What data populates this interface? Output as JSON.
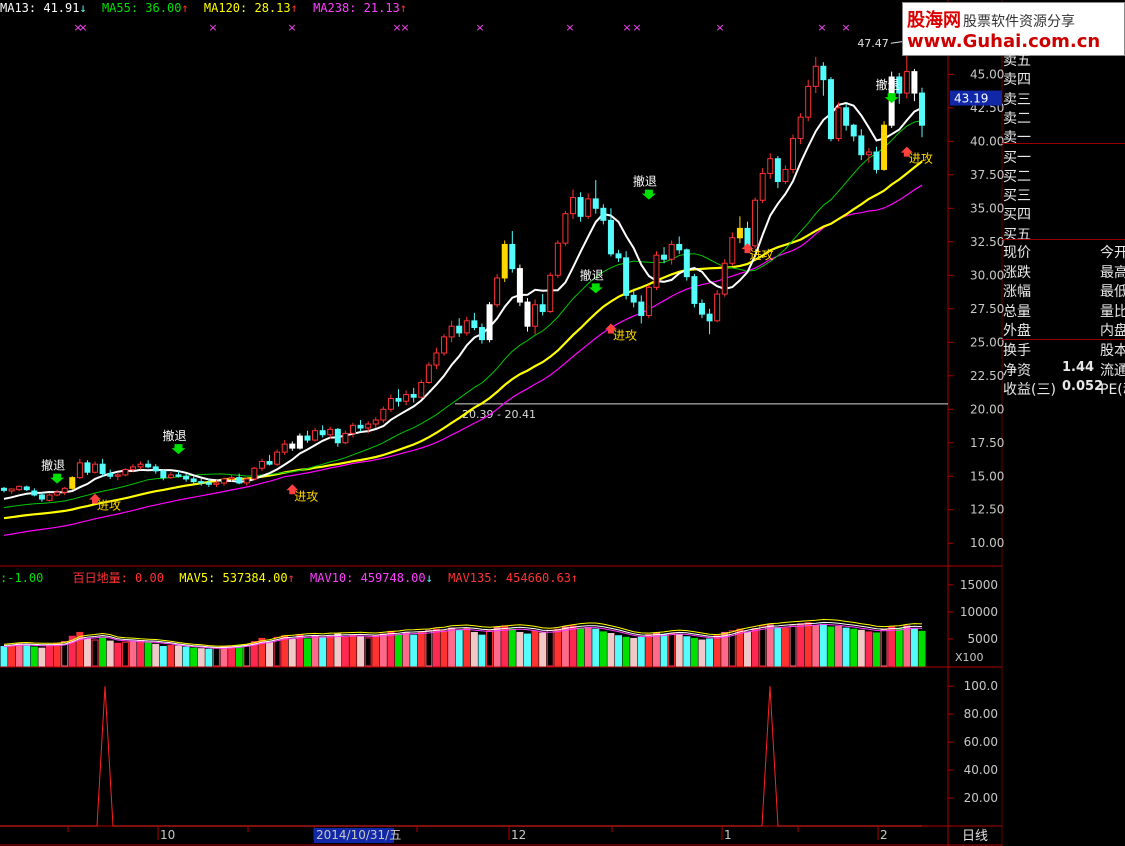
{
  "legend": {
    "ma13": "MA13: 41.91",
    "ma13_arrow": "↓",
    "ma55": "MA55: 36.00",
    "ma55_arrow": "↑",
    "ma120": "MA120: 28.13",
    "ma120_arrow": "↑",
    "ma238": "MA238: 21.13",
    "ma238_arrow": "↑"
  },
  "volume_legend": {
    "prefix": ":-1.00",
    "bairi": "百日地量: 0.00",
    "mav5": "MAV5: 537384.00",
    "mav5_arrow": "↑",
    "mav10": "MAV10: 459748.00",
    "mav10_arrow": "↓",
    "mav135": "MAV135: 454660.63",
    "mav135_arrow": "↑"
  },
  "watermark": {
    "brand": "股海网",
    "slogan": "股票软件资源分享",
    "url": "www.Guhai.com.cn"
  },
  "side_panel": {
    "order_book": [
      "卖五",
      "卖四",
      "卖三",
      "卖二",
      "卖一",
      "买一",
      "买二",
      "买三",
      "买四",
      "买五"
    ],
    "rows": [
      {
        "left": "现价",
        "right": "今开"
      },
      {
        "left": "涨跌",
        "right": "最高"
      },
      {
        "left": "涨幅",
        "right": "最低"
      },
      {
        "left": "总量",
        "right": "量比"
      },
      {
        "left": "外盘",
        "right": "内盘"
      }
    ],
    "rows2": [
      {
        "left": "换手",
        "value": "",
        "right": "股本"
      },
      {
        "left": "净资",
        "value": "1.44",
        "right": "流通"
      },
      {
        "left": "收益(三)",
        "value": "0.052",
        "right": "PE(动"
      }
    ]
  },
  "colors": {
    "up": "#ff3232",
    "down": "#54fcfc",
    "ma13": "#ffffff",
    "ma55": "#00c800",
    "ma120": "#ffff00",
    "ma238": "#ff00ff",
    "axis": "#b00000",
    "attack_bar": "#ffd700"
  },
  "chart_data": [
    {
      "type": "candlestick",
      "title": "",
      "yticks": [
        10.0,
        12.5,
        15.0,
        17.5,
        20.0,
        22.5,
        25.0,
        27.5,
        30.0,
        32.5,
        35.0,
        37.5,
        40.0,
        42.5,
        45.0,
        47.5
      ],
      "ylim": [
        8.6,
        49.8
      ],
      "current_price": "43.19",
      "high_label": "47.47",
      "range_label": "20.39 - 20.41",
      "reference_line": 20.4,
      "signals": {
        "retreat": "撤退",
        "attack": "进攻"
      },
      "candles": [
        [
          14.1,
          14.2,
          13.8,
          13.95
        ],
        [
          13.9,
          14.1,
          13.7,
          14.05
        ],
        [
          14.0,
          14.3,
          13.9,
          14.25
        ],
        [
          14.2,
          14.3,
          13.9,
          14.0
        ],
        [
          13.9,
          14.1,
          13.5,
          13.6
        ],
        [
          13.6,
          13.8,
          13.1,
          13.3
        ],
        [
          13.2,
          13.7,
          13.1,
          13.6
        ],
        [
          13.6,
          14.0,
          13.5,
          13.8
        ],
        [
          13.8,
          14.2,
          13.6,
          14.1
        ],
        [
          14.1,
          15.0,
          14.0,
          14.9
        ],
        [
          14.9,
          16.3,
          14.8,
          16.0
        ],
        [
          16.0,
          16.2,
          15.1,
          15.3
        ],
        [
          15.3,
          16.1,
          15.2,
          15.9
        ],
        [
          15.9,
          16.3,
          15.0,
          15.2
        ],
        [
          15.2,
          15.5,
          14.8,
          15.0
        ],
        [
          15.0,
          15.3,
          14.7,
          15.1
        ],
        [
          15.1,
          15.6,
          15.0,
          15.5
        ],
        [
          15.5,
          15.9,
          15.3,
          15.7
        ],
        [
          15.7,
          16.1,
          15.5,
          15.9
        ],
        [
          15.9,
          16.2,
          15.6,
          15.7
        ],
        [
          15.7,
          15.9,
          15.2,
          15.4
        ],
        [
          15.4,
          15.5,
          14.7,
          14.9
        ],
        [
          14.9,
          15.3,
          14.8,
          15.1
        ],
        [
          15.1,
          15.4,
          14.9,
          15.0
        ],
        [
          15.0,
          15.2,
          14.6,
          14.8
        ],
        [
          14.8,
          15.0,
          14.4,
          14.6
        ],
        [
          14.6,
          14.8,
          14.3,
          14.5
        ],
        [
          14.5,
          14.8,
          14.2,
          14.4
        ],
        [
          14.4,
          14.7,
          14.2,
          14.5
        ],
        [
          14.5,
          14.9,
          14.3,
          14.8
        ],
        [
          14.8,
          15.1,
          14.6,
          14.9
        ],
        [
          14.9,
          15.2,
          14.4,
          14.5
        ],
        [
          14.5,
          14.9,
          14.3,
          14.8
        ],
        [
          14.8,
          15.7,
          14.7,
          15.6
        ],
        [
          15.6,
          16.3,
          15.4,
          16.1
        ],
        [
          16.1,
          16.6,
          15.8,
          15.9
        ],
        [
          15.9,
          17.0,
          15.8,
          16.8
        ],
        [
          16.8,
          17.7,
          16.6,
          17.4
        ],
        [
          17.4,
          17.6,
          16.9,
          17.1
        ],
        [
          17.1,
          18.2,
          17.0,
          18.0
        ],
        [
          18.0,
          18.4,
          17.5,
          17.7
        ],
        [
          17.7,
          18.6,
          17.6,
          18.4
        ],
        [
          18.4,
          18.8,
          17.9,
          18.1
        ],
        [
          18.1,
          18.7,
          17.8,
          18.5
        ],
        [
          18.5,
          18.6,
          17.2,
          17.5
        ],
        [
          17.5,
          18.4,
          17.4,
          18.2
        ],
        [
          18.2,
          19.0,
          17.9,
          18.8
        ],
        [
          18.8,
          19.2,
          18.3,
          18.6
        ],
        [
          18.6,
          19.1,
          18.2,
          18.9
        ],
        [
          18.9,
          19.4,
          18.6,
          19.2
        ],
        [
          19.2,
          20.2,
          19.0,
          20.0
        ],
        [
          20.0,
          21.1,
          19.8,
          20.8
        ],
        [
          20.8,
          21.5,
          20.2,
          20.6
        ],
        [
          20.6,
          21.4,
          20.3,
          21.1
        ],
        [
          21.1,
          21.6,
          20.5,
          20.9
        ],
        [
          20.9,
          22.2,
          20.8,
          22.0
        ],
        [
          22.0,
          23.5,
          21.9,
          23.3
        ],
        [
          23.3,
          24.6,
          23.0,
          24.2
        ],
        [
          24.2,
          25.6,
          24.0,
          25.4
        ],
        [
          25.4,
          26.6,
          25.0,
          26.2
        ],
        [
          26.2,
          26.8,
          25.4,
          25.7
        ],
        [
          25.7,
          26.9,
          25.5,
          26.6
        ],
        [
          26.6,
          27.2,
          25.9,
          26.1
        ],
        [
          26.1,
          26.4,
          24.9,
          25.2
        ],
        [
          25.2,
          28.0,
          25.0,
          27.8
        ],
        [
          27.8,
          30.1,
          27.6,
          29.8
        ],
        [
          29.8,
          32.6,
          29.5,
          32.3
        ],
        [
          32.3,
          33.3,
          30.2,
          30.5
        ],
        [
          30.5,
          30.8,
          27.7,
          28.0
        ],
        [
          28.0,
          28.3,
          25.8,
          26.2
        ],
        [
          26.2,
          28.2,
          25.6,
          27.8
        ],
        [
          27.8,
          28.6,
          27.0,
          27.3
        ],
        [
          27.3,
          30.2,
          27.2,
          30.0
        ],
        [
          30.0,
          32.6,
          29.8,
          32.4
        ],
        [
          32.4,
          34.8,
          32.2,
          34.6
        ],
        [
          34.6,
          36.4,
          34.2,
          35.8
        ],
        [
          35.8,
          36.2,
          34.0,
          34.4
        ],
        [
          34.4,
          36.1,
          34.2,
          35.7
        ],
        [
          35.7,
          37.1,
          34.6,
          35.0
        ],
        [
          35.0,
          35.3,
          33.8,
          34.1
        ],
        [
          34.1,
          35.0,
          31.4,
          31.6
        ],
        [
          31.6,
          31.9,
          31.0,
          31.3
        ],
        [
          31.3,
          31.8,
          28.2,
          28.5
        ],
        [
          28.5,
          29.0,
          27.6,
          28.0
        ],
        [
          28.0,
          28.5,
          26.4,
          27.0
        ],
        [
          27.0,
          29.3,
          26.8,
          29.1
        ],
        [
          29.1,
          31.8,
          28.9,
          31.5
        ],
        [
          31.5,
          32.1,
          30.9,
          31.2
        ],
        [
          31.2,
          32.6,
          30.8,
          32.3
        ],
        [
          32.3,
          32.9,
          31.6,
          31.9
        ],
        [
          31.9,
          32.0,
          29.6,
          29.9
        ],
        [
          29.9,
          30.1,
          27.6,
          27.9
        ],
        [
          27.9,
          28.2,
          26.8,
          27.1
        ],
        [
          27.1,
          27.5,
          25.6,
          26.6
        ],
        [
          26.6,
          28.9,
          26.5,
          28.6
        ],
        [
          28.6,
          31.2,
          28.4,
          30.9
        ],
        [
          30.9,
          33.2,
          30.7,
          32.8
        ],
        [
          32.8,
          34.4,
          32.4,
          33.5
        ],
        [
          33.5,
          34.0,
          31.8,
          32.2
        ],
        [
          32.2,
          35.8,
          32.0,
          35.6
        ],
        [
          35.6,
          38.0,
          35.4,
          37.6
        ],
        [
          37.6,
          39.1,
          37.2,
          38.7
        ],
        [
          38.7,
          38.9,
          36.5,
          37.0
        ],
        [
          37.0,
          38.2,
          36.8,
          37.9
        ],
        [
          37.9,
          40.5,
          37.6,
          40.2
        ],
        [
          40.2,
          42.1,
          39.8,
          41.8
        ],
        [
          41.8,
          44.6,
          41.5,
          44.1
        ],
        [
          44.1,
          46.3,
          43.6,
          45.6
        ],
        [
          45.6,
          45.9,
          43.4,
          44.6
        ],
        [
          44.6,
          44.8,
          40.0,
          40.2
        ],
        [
          40.2,
          42.9,
          40.0,
          42.5
        ],
        [
          42.5,
          42.8,
          40.8,
          41.2
        ],
        [
          41.2,
          41.3,
          40.0,
          40.4
        ],
        [
          40.4,
          40.9,
          38.6,
          39.0
        ],
        [
          39.0,
          39.5,
          38.4,
          39.2
        ],
        [
          39.2,
          39.6,
          37.6,
          37.9
        ],
        [
          37.9,
          41.5,
          37.8,
          41.2
        ],
        [
          41.2,
          45.2,
          41.0,
          44.8
        ],
        [
          44.8,
          45.1,
          42.8,
          43.6
        ],
        [
          43.6,
          47.5,
          43.2,
          45.2
        ],
        [
          45.2,
          45.4,
          43.0,
          43.6
        ],
        [
          43.6,
          44.0,
          40.3,
          41.2
        ]
      ]
    },
    {
      "type": "bar",
      "title": "",
      "yticks": [
        5000,
        10000,
        15000
      ],
      "unit": "X100",
      "ylim": [
        0,
        17000
      ],
      "values": [
        3600,
        3800,
        4100,
        4000,
        3500,
        3300,
        3900,
        4200,
        4500,
        5500,
        6200,
        5000,
        4800,
        5300,
        4600,
        4200,
        4400,
        4500,
        4700,
        4300,
        4000,
        3600,
        3800,
        3700,
        3500,
        3300,
        3200,
        3100,
        3300,
        3500,
        3600,
        3800,
        3900,
        4500,
        5100,
        4400,
        5300,
        5600,
        4900,
        5800,
        5000,
        5600,
        5200,
        5500,
        5900,
        5300,
        5700,
        5400,
        5200,
        5600,
        5900,
        6400,
        5800,
        6100,
        5700,
        6300,
        6600,
        6800,
        6500,
        7000,
        6600,
        6900,
        6200,
        5700,
        6500,
        7200,
        7400,
        6800,
        6200,
        5900,
        6400,
        6100,
        6600,
        6800,
        7200,
        7400,
        7000,
        7100,
        6800,
        6300,
        6000,
        5600,
        5300,
        5100,
        5300,
        5800,
        6100,
        5800,
        6000,
        5900,
        5400,
        5100,
        4800,
        5000,
        5600,
        6200,
        6500,
        6800,
        6300,
        6900,
        7400,
        7600,
        7100,
        7000,
        7400,
        7800,
        8000,
        7500,
        7700,
        7200,
        7300,
        7000,
        6800,
        6600,
        6300,
        6100,
        6700,
        7200,
        6900,
        7400,
        6800,
        6400
      ],
      "ma_values": [
        4100,
        4300,
        4500,
        4700,
        4600,
        4800,
        5000,
        5200,
        5400,
        5600,
        5800,
        6000
      ]
    },
    {
      "type": "line",
      "title": "",
      "yticks": [
        20.0,
        40.0,
        60.0,
        80.0,
        100.0
      ],
      "ylim": [
        0,
        113
      ],
      "values": [
        0,
        0,
        0,
        0,
        0,
        0,
        0,
        0,
        0,
        0,
        0,
        0,
        0,
        0,
        0,
        0,
        0,
        0,
        0,
        0,
        0,
        0,
        0,
        0,
        0,
        0,
        0,
        0,
        0,
        0,
        0,
        0,
        0,
        0,
        0,
        0,
        0,
        0,
        0,
        0,
        0,
        0,
        0,
        0,
        0,
        0,
        0,
        0,
        0,
        0,
        0,
        0,
        0,
        0,
        0,
        0,
        0,
        0,
        0,
        0,
        0,
        0,
        0,
        0,
        0,
        0,
        0,
        0,
        0,
        0,
        0,
        0,
        0,
        0,
        0,
        0,
        0,
        0,
        0,
        0,
        0,
        0,
        0,
        0,
        0,
        0,
        0,
        0,
        0,
        0,
        0,
        0,
        0,
        0,
        0,
        0,
        0,
        0,
        0,
        0,
        0,
        0,
        0,
        0,
        0,
        0,
        0,
        0,
        0,
        0,
        0,
        0,
        0,
        0,
        0,
        0,
        0,
        0,
        0,
        0,
        0,
        0
      ],
      "spikes": [
        {
          "x": 105,
          "value": 100
        },
        {
          "x": 770,
          "value": 100
        }
      ],
      "xticks": [
        {
          "label": "10",
          "x": 160
        },
        {
          "label": "2014/10/31/五",
          "x": 316,
          "highlight": true
        },
        {
          "label": "12",
          "x": 511
        },
        {
          "label": "1",
          "x": 724
        },
        {
          "label": "2",
          "x": 880
        }
      ],
      "period": "日线"
    }
  ]
}
